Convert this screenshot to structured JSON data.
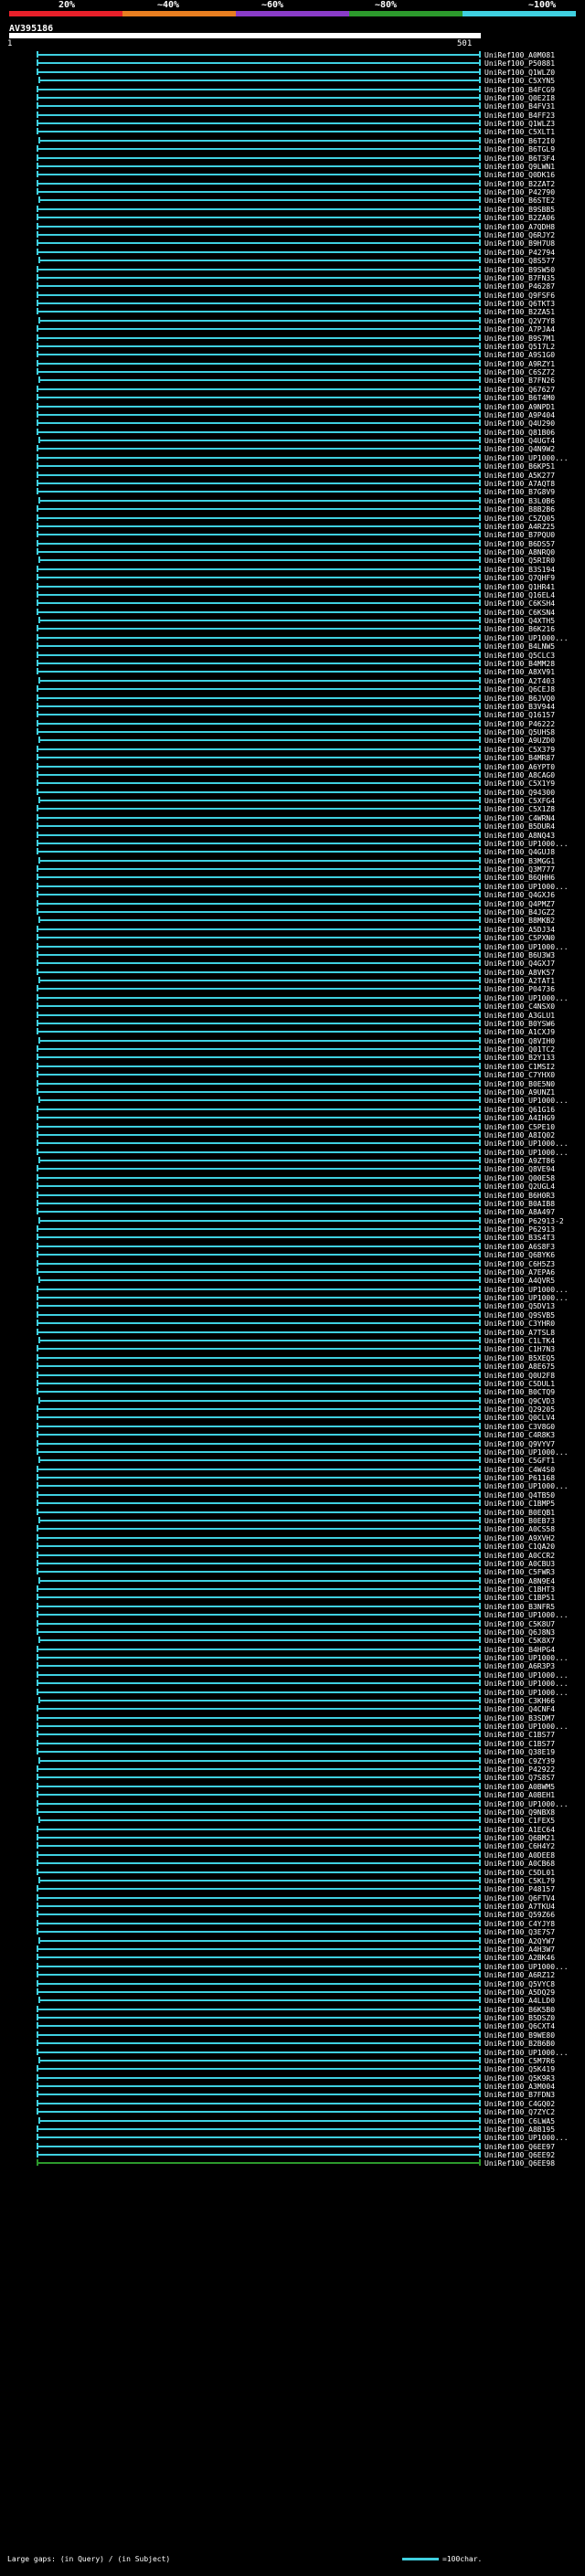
{
  "legend": {
    "thresholds": [
      "20%",
      "~40%",
      "~60%",
      "~80%",
      "~100%"
    ],
    "colors": [
      "#e8202a",
      "#e87e20",
      "#8a3cc8",
      "#2c9a2c",
      "#3fd0e0"
    ]
  },
  "query": {
    "name": "AV395186",
    "start": "1",
    "end": "501"
  },
  "hits": [
    "UniRef100_A0M081",
    "UniRef100_P50881",
    "UniRef100_Q1WLZ0",
    "UniRef100_C5XYN5",
    "UniRef100_B4FCG9",
    "UniRef100_Q0E2I8",
    "UniRef100_B4FV31",
    "UniRef100_B4FF23",
    "UniRef100_Q1WLZ3",
    "UniRef100_C5XLT1",
    "UniRef100_B6T2I0",
    "UniRef100_B6TGL9",
    "UniRef100_B6T3F4",
    "UniRef100_Q9LWN1",
    "UniRef100_Q0DK16",
    "UniRef100_B2ZAT2",
    "UniRef100_P42790",
    "UniRef100_B6STE2",
    "UniRef100_B9SBB5",
    "UniRef100_B2ZA06",
    "UniRef100_A7QDH8",
    "UniRef100_Q6RJY2",
    "UniRef100_B9H7U8",
    "UniRef100_P42794",
    "UniRef100_Q8S577",
    "UniRef100_B9SW50",
    "UniRef100_B7FN35",
    "UniRef100_P46287",
    "UniRef100_Q9FSF6",
    "UniRef100_Q6TKT3",
    "UniRef100_B2ZA51",
    "UniRef100_Q2V7Y8",
    "UniRef100_A7PJA4",
    "UniRef100_B9S7M1",
    "UniRef100_Q517L2",
    "UniRef100_A9S1G0",
    "UniRef100_A9RZY1",
    "UniRef100_C6SZ72",
    "UniRef100_B7FN26",
    "UniRef100_Q67627",
    "UniRef100_B6T4M0",
    "UniRef100_A9NPD1",
    "UniRef100_A9P404",
    "UniRef100_Q4U290",
    "UniRef100_Q81B06",
    "UniRef100_Q4UGT4",
    "UniRef100_Q4N9W2",
    "UniRef100_UP1000...",
    "UniRef100_B6KP51",
    "UniRef100_A5K277",
    "UniRef100_A7AQT8",
    "UniRef100_B7G8V9",
    "UniRef100_B3L0B6",
    "UniRef100_B8B2B6",
    "UniRef100_C5ZQ05",
    "UniRef100_A4RZ25",
    "UniRef100_B7PQU0",
    "UniRef100_B6DS57",
    "UniRef100_A8NRQ0",
    "UniRef100_Q5RIR0",
    "UniRef100_B3S194",
    "UniRef100_Q7QHF9",
    "UniRef100_Q1HR41",
    "UniRef100_Q16EL4",
    "UniRef100_C6KSH4",
    "UniRef100_C6KSN4",
    "UniRef100_Q4XTH5",
    "UniRef100_B6K216",
    "UniRef100_UP1000...",
    "UniRef100_B4LNW5",
    "UniRef100_Q5CLC3",
    "UniRef100_B4MM28",
    "UniRef100_A8XV91",
    "UniRef100_A2T403",
    "UniRef100_Q6CEJ8",
    "UniRef100_B6JVQ0",
    "UniRef100_B3V944",
    "UniRef100_Q16157",
    "UniRef100_P46222",
    "UniRef100_Q5UHS8",
    "UniRef100_A9UZD0",
    "UniRef100_C5X379",
    "UniRef100_B4MR87",
    "UniRef100_A6YPT0",
    "UniRef100_A8CAG0",
    "UniRef100_C5X1Y9",
    "UniRef100_Q94300",
    "UniRef100_C5XFG4",
    "UniRef100_C5X1Z8",
    "UniRef100_C4WRN4",
    "UniRef100_B5DUR4",
    "UniRef100_A8NQ43",
    "UniRef100_UP1000...",
    "UniRef100_Q4GUJ8",
    "UniRef100_B3MGG1",
    "UniRef100_Q3M777",
    "UniRef100_B6QHH6",
    "UniRef100_UP1000...",
    "UniRef100_Q4GXJ6",
    "UniRef100_Q4PMZ7",
    "UniRef100_B4JGZ2",
    "UniRef100_B8MKB2",
    "UniRef100_A5DJ34",
    "UniRef100_C5PXN0",
    "UniRef100_UP1000...",
    "UniRef100_B6U3W3",
    "UniRef100_Q4GXJ7",
    "UniRef100_A8VK57",
    "UniRef100_A2TAT1",
    "UniRef100_P04736",
    "UniRef100_UP1000...",
    "UniRef100_C4NSX0",
    "UniRef100_A3GLU1",
    "UniRef100_B0YSW6",
    "UniRef100_A1CXJ9",
    "UniRef100_Q8VIH0",
    "UniRef100_Q01TC2",
    "UniRef100_B2Y133",
    "UniRef100_C1MSI2",
    "UniRef100_C7YHX0",
    "UniRef100_B0E5N0",
    "UniRef100_A9UNZ1",
    "UniRef100_UP1000...",
    "UniRef100_Q61G16",
    "UniRef100_A4IHG9",
    "UniRef100_C5PE10",
    "UniRef100_A8IQ02",
    "UniRef100_UP1000...",
    "UniRef100_UP1000...",
    "UniRef100_A9ZT86",
    "UniRef100_Q8VE94",
    "UniRef100_Q00E58",
    "UniRef100_Q2UGL4",
    "UniRef100_B6H0R3",
    "UniRef100_B0AIB8",
    "UniRef100_A8A497",
    "UniRef100_P62913-2",
    "UniRef100_P62913",
    "UniRef100_B3S4T3",
    "UniRef100_A6S8F3",
    "UniRef100_Q6BYK6",
    "UniRef100_C6H5Z3",
    "UniRef100_A7EPA6",
    "UniRef100_A4QVR5",
    "UniRef100_UP1000...",
    "UniRef100_UP1000...",
    "UniRef100_Q5DV13",
    "UniRef100_Q9SVB5",
    "UniRef100_C3YHR0",
    "UniRef100_A7TSL8",
    "UniRef100_C1LTK4",
    "UniRef100_C1H7N3",
    "UniRef100_B5XEQ5",
    "UniRef100_A8E675",
    "UniRef100_Q0U2F8",
    "UniRef100_C5DUL1",
    "UniRef100_B0CTQ9",
    "UniRef100_Q9CVD3",
    "UniRef100_Q29205",
    "UniRef100_Q0CLV4",
    "UniRef100_C3V8G0",
    "UniRef100_C4R8K3",
    "UniRef100_Q9VYV7",
    "UniRef100_UP1000...",
    "UniRef100_C5GFT1",
    "UniRef100_C4W4S0",
    "UniRef100_P61168",
    "UniRef100_UP1000...",
    "UniRef100_Q4TB50",
    "UniRef100_C1BMP5",
    "UniRef100_B0EQB1",
    "UniRef100_B0EB73",
    "UniRef100_A0CS58",
    "UniRef100_A9XVH2",
    "UniRef100_C1QA20",
    "UniRef100_A0CCR2",
    "UniRef100_A0CBU3",
    "UniRef100_C5FWR3",
    "UniRef100_A8N9E4",
    "UniRef100_C1BHT3",
    "UniRef100_C1BP51",
    "UniRef100_B3NFR5",
    "UniRef100_UP1000...",
    "UniRef100_C5K8U7",
    "UniRef100_Q6J8N3",
    "UniRef100_C5K8X7",
    "UniRef100_B4HPG4",
    "UniRef100_UP1000...",
    "UniRef100_A6R3P3",
    "UniRef100_UP1000...",
    "UniRef100_UP1000...",
    "UniRef100_UP1000...",
    "UniRef100_C3KH66",
    "UniRef100_Q4CNF4",
    "UniRef100_B3SDM7",
    "UniRef100_UP1000...",
    "UniRef100_C1BS77",
    "UniRef100_C1BS77",
    "UniRef100_Q38E19",
    "UniRef100_C9ZY39",
    "UniRef100_P42922",
    "UniRef100_Q7S8S7",
    "UniRef100_A0BWM5",
    "UniRef100_A0BEH1",
    "UniRef100_UP1000...",
    "UniRef100_Q9NBX8",
    "UniRef100_C1FEX5",
    "UniRef100_A1EC64",
    "UniRef100_Q6BM21",
    "UniRef100_C6H4Y2",
    "UniRef100_A0DEE8",
    "UniRef100_A0CB68",
    "UniRef100_C5DL01",
    "UniRef100_C5KL79",
    "UniRef100_P48157",
    "UniRef100_Q6FTV4",
    "UniRef100_A7TKU4",
    "UniRef100_Q59Z66",
    "UniRef100_C4YJY8",
    "UniRef100_Q3E7S7",
    "UniRef100_A2QYW7",
    "UniRef100_A4H3W7",
    "UniRef100_A2BK46",
    "UniRef100_UP1000...",
    "UniRef100_A6RZ12",
    "UniRef100_Q5VYC8",
    "UniRef100_A5DQ29",
    "UniRef100_A4LLD0",
    "UniRef100_B6K5B0",
    "UniRef100_B5DSZ0",
    "UniRef100_Q6CXT4",
    "UniRef100_B9WE80",
    "UniRef100_B2B6B0",
    "UniRef100_UP1000...",
    "UniRef100_C5M7R6",
    "UniRef100_Q5K419",
    "UniRef100_Q5K9R3",
    "UniRef100_A3M004",
    "UniRef100_B7FDN3",
    "UniRef100_C4GQ02",
    "UniRef100_Q7ZYC2",
    "UniRef100_C6LWA5",
    "UniRef100_A8B195",
    "UniRef100_UP1000...",
    "UniRef100_Q6EE97",
    "UniRef100_Q6EE92",
    "UniRef100_Q6EE98"
  ],
  "footer": {
    "gaps_label": "Large gaps:",
    "in_query": "(in Query)",
    "in_subject": "(in Subject)",
    "scale_label": "=100char."
  }
}
